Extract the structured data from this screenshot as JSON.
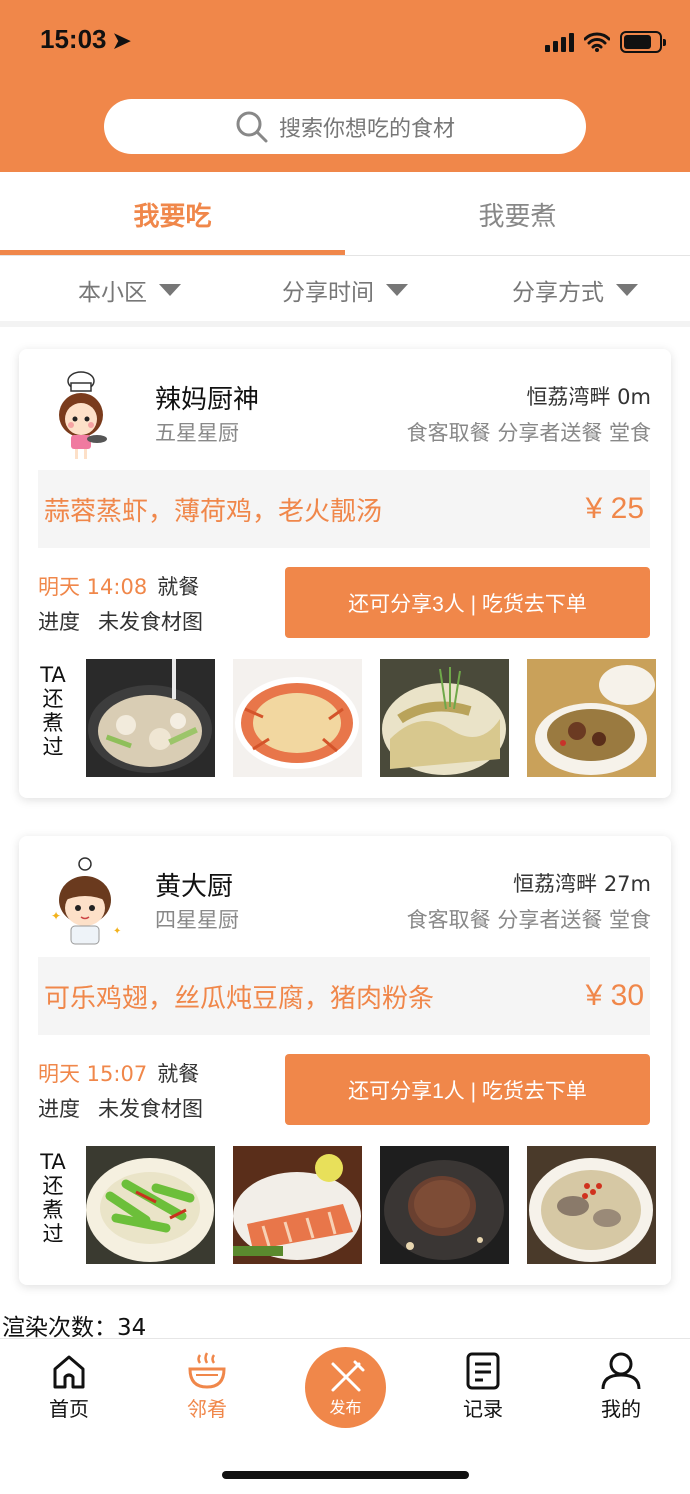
{
  "status_bar": {
    "time": "15:03"
  },
  "search": {
    "placeholder": "搜索你想吃的食材"
  },
  "tabs": [
    {
      "label": "我要吃",
      "active": true
    },
    {
      "label": "我要煮",
      "active": false
    }
  ],
  "filters": [
    {
      "label": "本小区"
    },
    {
      "label": "分享时间"
    },
    {
      "label": "分享方式"
    }
  ],
  "cards": [
    {
      "chef_name": "辣妈厨神",
      "chef_level": "五星星厨",
      "location": "恒荔湾畔 0m",
      "methods": "食客取餐 分享者送餐 堂食",
      "dishes": "蒜蓉蒸虾，薄荷鸡，老火靓汤",
      "price": "¥ 25",
      "meal_time": "明天 14:08",
      "meal_label": "就餐",
      "progress_label": "进度",
      "progress_value": "未发食材图",
      "order_button": "还可分享3人 | 吃货去下单",
      "cooked_label": "TA还煮过"
    },
    {
      "chef_name": "黄大厨",
      "chef_level": "四星星厨",
      "location": "恒荔湾畔 27m",
      "methods": "食客取餐 分享者送餐 堂食",
      "dishes": "可乐鸡翅，丝瓜炖豆腐，猪肉粉条",
      "price": "¥ 30",
      "meal_time": "明天 15:07",
      "meal_label": "就餐",
      "progress_label": "进度",
      "progress_value": "未发食材图",
      "order_button": "还可分享1人 | 吃货去下单",
      "cooked_label": "TA还煮过"
    }
  ],
  "render_count": "渲染次数：34",
  "bottom_nav": [
    {
      "label": "首页",
      "icon": "home-icon"
    },
    {
      "label": "邻肴",
      "icon": "bowl-icon",
      "active": true
    },
    {
      "label": "发布",
      "icon": "fork-knife-icon"
    },
    {
      "label": "记录",
      "icon": "notes-icon"
    },
    {
      "label": "我的",
      "icon": "person-icon"
    }
  ],
  "colors": {
    "accent": "#f0874a"
  }
}
